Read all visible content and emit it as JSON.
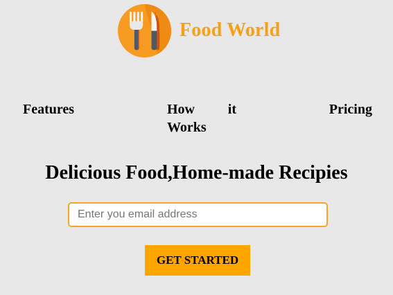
{
  "brand": {
    "name": "Food World",
    "logo_icon": "fork-knife-icon",
    "colors": {
      "brand_text": "#f6a01a",
      "logo_circle": "#f79a22"
    }
  },
  "nav": {
    "items": [
      {
        "label": "Features"
      },
      {
        "label": "How it Works"
      },
      {
        "label": "Pricing"
      }
    ]
  },
  "hero": {
    "title": "Delicious Food,Home-made Recipies"
  },
  "signup": {
    "email_placeholder": "Enter you email address",
    "email_value": "",
    "button_label": "GET STARTED",
    "colors": {
      "input_border": "#f6a623",
      "button_bg": "#ffa500"
    }
  },
  "page": {
    "background": "#e8e8e8"
  }
}
